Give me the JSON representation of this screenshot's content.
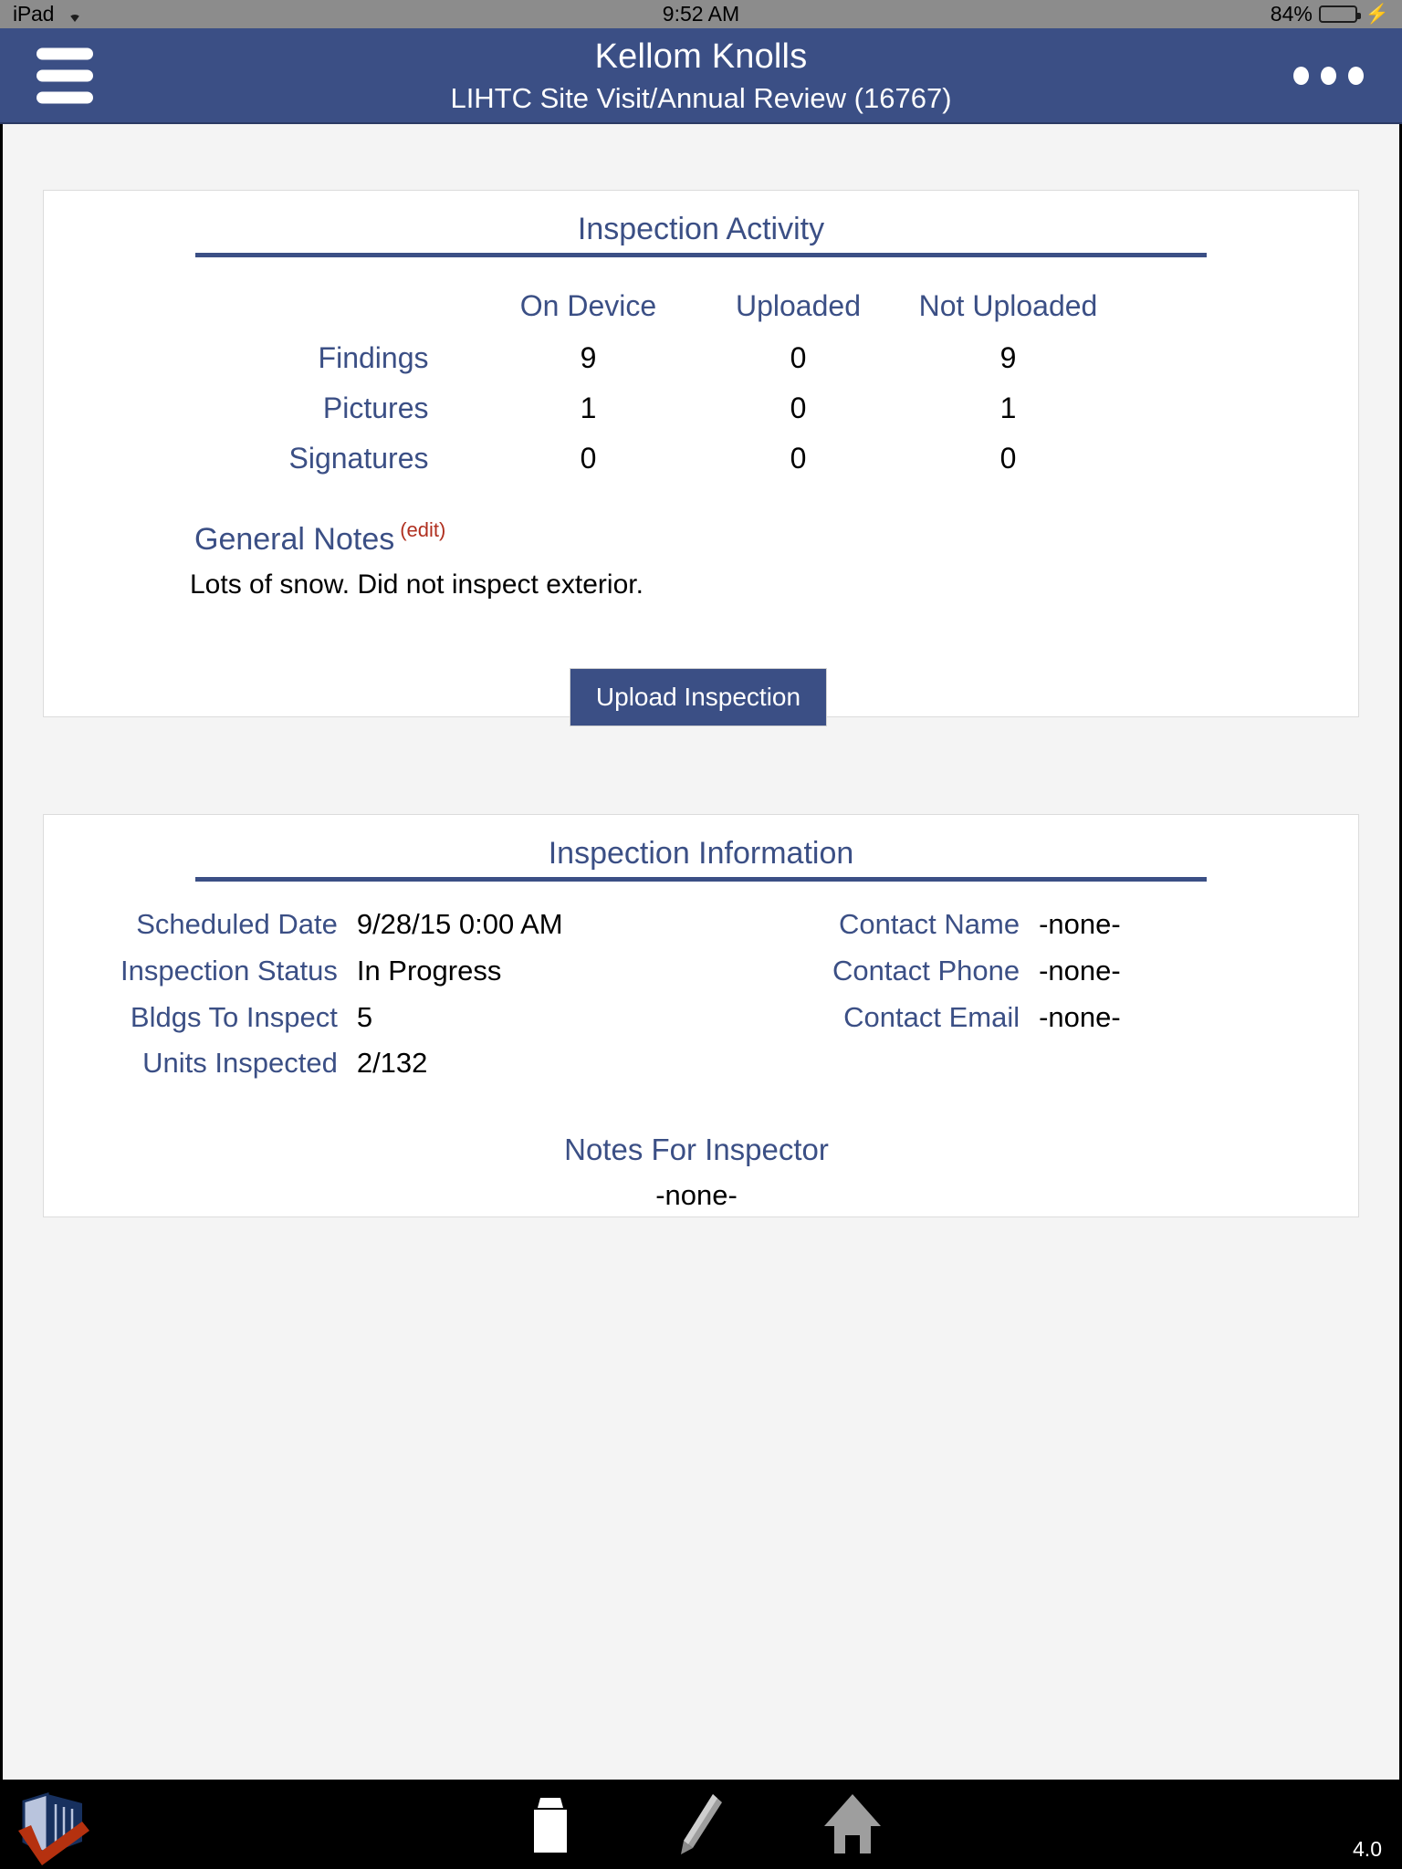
{
  "status_bar": {
    "device": "iPad",
    "wifi_icon": "wifi-icon",
    "time": "9:52 AM",
    "battery_percent": "84%",
    "battery_level": 84,
    "charging_icon": "lightning-bolt-icon"
  },
  "navbar": {
    "menu_icon": "hamburger-menu-icon",
    "title": "Kellom Knolls",
    "subtitle": "LIHTC Site Visit/Annual Review (16767)",
    "more_icon": "more-options-icon"
  },
  "inspection_activity": {
    "title": "Inspection Activity",
    "columns": [
      "On Device",
      "Uploaded",
      "Not Uploaded"
    ],
    "rows": [
      {
        "label": "Findings",
        "on_device": "9",
        "uploaded": "0",
        "not_uploaded": "9"
      },
      {
        "label": "Pictures",
        "on_device": "1",
        "uploaded": "0",
        "not_uploaded": "1"
      },
      {
        "label": "Signatures",
        "on_device": "0",
        "uploaded": "0",
        "not_uploaded": "0"
      }
    ],
    "general_notes_label": "General Notes",
    "general_notes_edit": "(edit)",
    "general_notes_text": "Lots of snow. Did not inspect exterior.",
    "upload_button": "Upload Inspection"
  },
  "inspection_information": {
    "title": "Inspection Information",
    "left_fields": [
      {
        "label": "Scheduled Date",
        "value": "9/28/15 0:00 AM"
      },
      {
        "label": "Inspection Status",
        "value": "In Progress"
      },
      {
        "label": "Bldgs To Inspect",
        "value": "5"
      },
      {
        "label": "Units Inspected",
        "value": "2/132"
      }
    ],
    "right_fields": [
      {
        "label": "Contact Name",
        "value": "-none-"
      },
      {
        "label": "Contact Phone",
        "value": "-none-"
      },
      {
        "label": "Contact Email",
        "value": "-none-"
      }
    ],
    "notes_for_inspector_label": "Notes For Inspector",
    "notes_for_inspector_value": "-none-"
  },
  "toolbar": {
    "logo_icon": "app-logo-building-check-icon",
    "items": [
      {
        "icon": "briefcase-icon",
        "name": "briefcase-icon"
      },
      {
        "icon": "pencil-icon",
        "name": "pencil-icon"
      },
      {
        "icon": "home-icon",
        "name": "home-icon"
      }
    ],
    "version": "4.0"
  },
  "colors": {
    "brand_blue": "#3b4f85",
    "status_bar_gray": "#8c8c8c",
    "page_bg": "#f4f4f4",
    "edit_link_red": "#b03020",
    "battery_green": "#4cd964"
  }
}
